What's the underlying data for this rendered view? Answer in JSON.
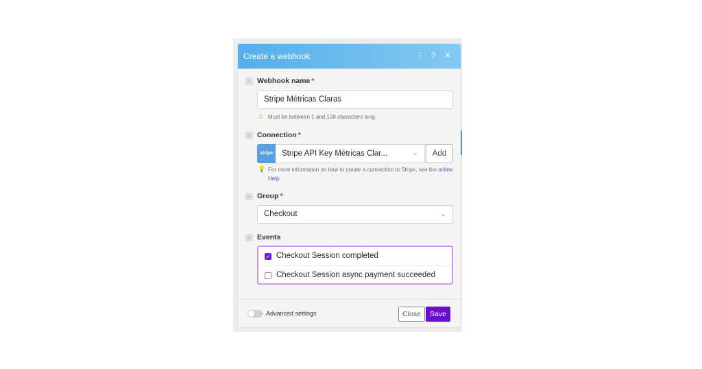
{
  "dialog": {
    "title": "Create a webhook",
    "menu_icon": "⋮",
    "help_icon": "?",
    "close_icon": "×"
  },
  "webhook_name": {
    "label": "Webhook name",
    "required_mark": "*",
    "value": "Stripe Métricas Claras",
    "hint": "Must be between 1 and 128 characters long."
  },
  "connection": {
    "label": "Connection",
    "required_mark": "*",
    "logo_text": "stripe",
    "value": "Stripe API Key Métricas Clar...",
    "add_label": "Add",
    "hint_text": "For more information on how to create a connection to Stripe, see the ",
    "hint_link": "online Help",
    "hint_end": "."
  },
  "group": {
    "label": "Group",
    "required_mark": "*",
    "value": "Checkout"
  },
  "events": {
    "label": "Events",
    "items": [
      {
        "label": "Checkout Session completed",
        "checked": true
      },
      {
        "label": "Checkout Session async payment succeeded",
        "checked": false
      }
    ]
  },
  "footer": {
    "advanced_label": "Advanced settings",
    "close_label": "Close",
    "save_label": "Save"
  },
  "colors": {
    "header_start": "#55aeea",
    "accent_purple": "#6a0dc8",
    "required_red": "#e0245e",
    "stripe_blue": "#5a9fe0"
  }
}
